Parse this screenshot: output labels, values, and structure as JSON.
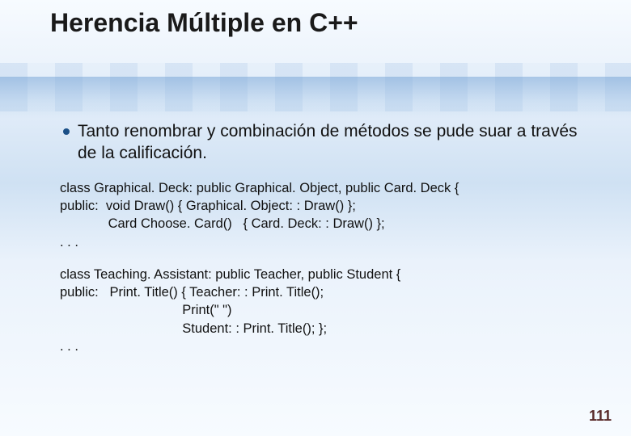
{
  "title": "Herencia Múltiple en  C++",
  "bullet": "Tanto renombrar y combinación de métodos se pude suar a través de la calificación.",
  "code1": {
    "l0": "class Graphical. Deck: public Graphical. Object, public Card. Deck {",
    "l1": "public:  void Draw() { Graphical. Object: : Draw() };",
    "l2": "             Card Choose. Card()   { Card. Deck: : Draw() };",
    "l3": ". . ."
  },
  "code2": {
    "l0": "class Teaching. Assistant: public Teacher, public Student {",
    "l1": "public:   Print. Title() { Teacher: : Print. Title();",
    "l2": "                                 Print(\" \")",
    "l3": "                                 Student: : Print. Title(); };",
    "l4": ". . ."
  },
  "page": "111"
}
